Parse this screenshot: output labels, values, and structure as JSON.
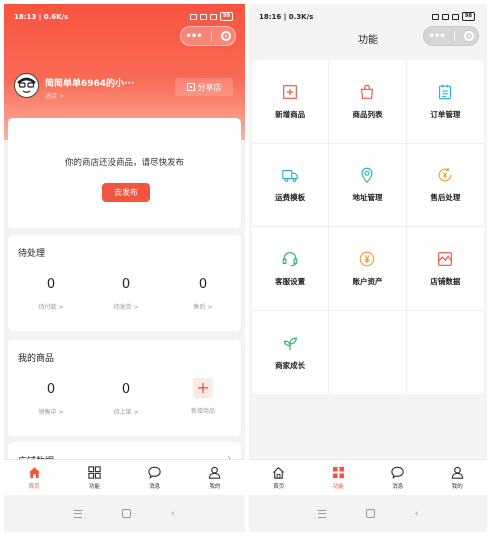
{
  "left": {
    "status_time": "18:13 | 0.6K/s",
    "battery": "99",
    "store_name": "简简单单6964的小···",
    "store_sub": "进店 >",
    "share_label": "分享店",
    "empty_text": "你的商店还没商品，请尽快发布",
    "publish_label": "去发布",
    "pending": {
      "title": "待处理",
      "items": [
        {
          "value": "0",
          "label": "待付款 >"
        },
        {
          "value": "0",
          "label": "待发货 >"
        },
        {
          "value": "0",
          "label": "售后 >"
        }
      ]
    },
    "goods": {
      "title": "我的商品",
      "items": [
        {
          "value": "0",
          "label": "销售中 >"
        },
        {
          "value": "0",
          "label": "待上架 >"
        }
      ],
      "add_label": "新增商品"
    },
    "data_title": "店铺数据",
    "tabs": [
      {
        "label": "首页",
        "icon": "home-icon",
        "active": true
      },
      {
        "label": "功能",
        "icon": "grid-icon",
        "active": false
      },
      {
        "label": "消息",
        "icon": "message-icon",
        "active": false
      },
      {
        "label": "我的",
        "icon": "user-icon",
        "active": false
      }
    ]
  },
  "right": {
    "status_time": "18:16 | 0.3K/s",
    "battery": "98",
    "title": "功能",
    "functions": [
      {
        "label": "新增商品",
        "icon": "add-product-icon",
        "color": "#f4553f"
      },
      {
        "label": "商品列表",
        "icon": "shopping-bag-icon",
        "color": "#f4553f"
      },
      {
        "label": "订单管理",
        "icon": "clipboard-icon",
        "color": "#2bb3c9"
      },
      {
        "label": "运费模板",
        "icon": "truck-icon",
        "color": "#2bb3c9"
      },
      {
        "label": "地址管理",
        "icon": "location-pin-icon",
        "color": "#2bb3c9"
      },
      {
        "label": "售后处理",
        "icon": "refund-icon",
        "color": "#f0a030"
      },
      {
        "label": "客服设置",
        "icon": "headset-icon",
        "color": "#2bb36a"
      },
      {
        "label": "账户资产",
        "icon": "yen-coin-icon",
        "color": "#f0a030"
      },
      {
        "label": "店铺数据",
        "icon": "chart-icon",
        "color": "#f4553f"
      },
      {
        "label": "商家成长",
        "icon": "sprout-icon",
        "color": "#2bb36a"
      }
    ],
    "tabs": [
      {
        "label": "首页",
        "icon": "home-icon",
        "active": false
      },
      {
        "label": "功能",
        "icon": "grid-icon",
        "active": true
      },
      {
        "label": "消息",
        "icon": "message-icon",
        "active": false
      },
      {
        "label": "我的",
        "icon": "user-icon",
        "active": false
      }
    ]
  },
  "accent_color": "#f4553f"
}
